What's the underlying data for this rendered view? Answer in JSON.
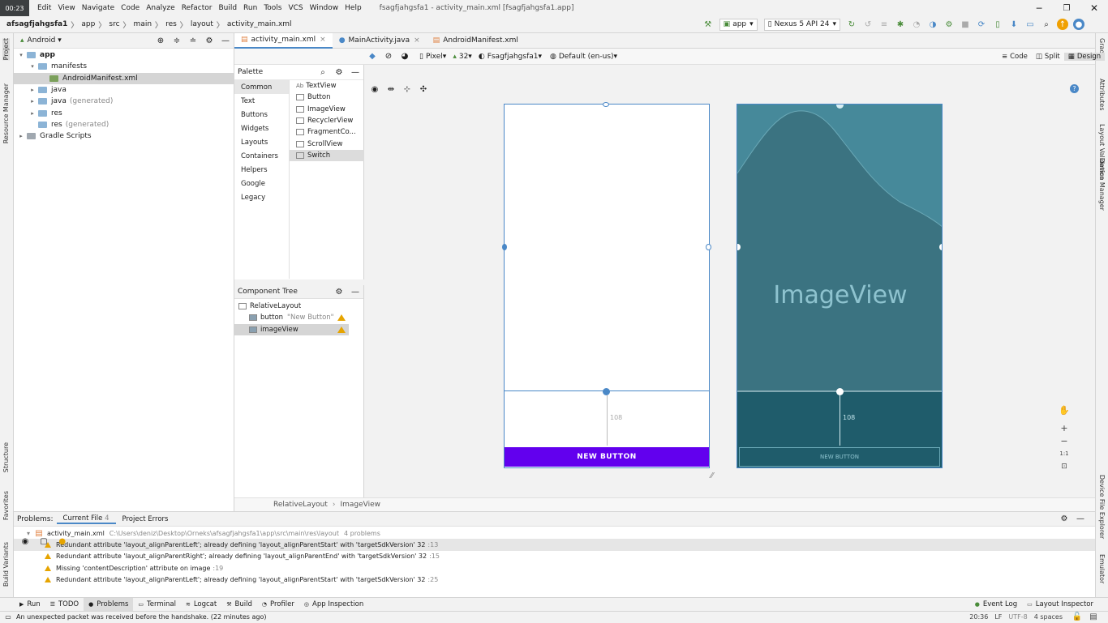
{
  "window": {
    "clock": "00:23",
    "title": "fsagfjahgsfa1 - activity_main.xml [fsagfjahgsfa1.app]",
    "menu": [
      "Edit",
      "View",
      "Navigate",
      "Code",
      "Analyze",
      "Refactor",
      "Build",
      "Run",
      "Tools",
      "VCS",
      "Window",
      "Help"
    ]
  },
  "breadcrumb": [
    "afsagfjahgsfa1",
    "app",
    "src",
    "main",
    "res",
    "layout",
    "activity_main.xml"
  ],
  "run_config": {
    "module": "app",
    "device": "Nexus 5 API 24"
  },
  "project": {
    "view": "Android",
    "tree": [
      {
        "label": "app",
        "indent": 0,
        "arrow": "▾",
        "icon": "folder",
        "bold": true
      },
      {
        "label": "manifests",
        "indent": 1,
        "arrow": "▾",
        "icon": "folder"
      },
      {
        "label": "AndroidManifest.xml",
        "indent": 2,
        "arrow": "",
        "icon": "file",
        "selected": true
      },
      {
        "label": "java",
        "indent": 1,
        "arrow": "▸",
        "icon": "folder"
      },
      {
        "label": "java",
        "suffix": "(generated)",
        "indent": 1,
        "arrow": "▸",
        "icon": "folder"
      },
      {
        "label": "res",
        "indent": 1,
        "arrow": "▸",
        "icon": "folder"
      },
      {
        "label": "res",
        "suffix": "(generated)",
        "indent": 1,
        "arrow": "",
        "icon": "folder"
      },
      {
        "label": "Gradle Scripts",
        "indent": 0,
        "arrow": "▸",
        "icon": "gradle"
      }
    ]
  },
  "left_strip": {
    "project": "Project",
    "resource_manager": "Resource Manager",
    "structure": "Structure",
    "favorites": "Favorites",
    "build_variants": "Build Variants"
  },
  "right_strip": {
    "gradle": "Gradle",
    "attributes": "Attributes",
    "layout_validation": "Layout Validation",
    "device_manager": "Device Manager",
    "device_file_explorer": "Device File Explorer",
    "emulator": "Emulator"
  },
  "editor_tabs": [
    "activity_main.xml",
    "MainActivity.java",
    "AndroidManifest.xml"
  ],
  "view_modes": [
    "Code",
    "Split",
    "Design"
  ],
  "design_toolbar": {
    "device": "Pixel",
    "api": "32",
    "theme": "Fsagfjahgsfa1",
    "locale": "Default (en-us)"
  },
  "palette": {
    "title": "Palette",
    "categories": [
      "Common",
      "Text",
      "Buttons",
      "Widgets",
      "Layouts",
      "Containers",
      "Helpers",
      "Google",
      "Legacy"
    ],
    "items": [
      "TextView",
      "Button",
      "ImageView",
      "RecyclerView",
      "FragmentCo...",
      "ScrollView",
      "Switch"
    ]
  },
  "component_tree": {
    "title": "Component Tree",
    "root": "RelativeLayout",
    "children": [
      {
        "label": "button",
        "hint": "\"New Button\"",
        "warning": true
      },
      {
        "label": "imageView",
        "hint": "",
        "warning": true,
        "selected": true
      }
    ]
  },
  "preview": {
    "button_label": "NEW BUTTON",
    "button_label_design": "NEW BUTTON",
    "margin_value": "108",
    "imageview_label": "ImageView",
    "accent_button": "#6200ee",
    "blueprint_line": "#4a88c7",
    "design_bg": "#3b7381"
  },
  "canvas_crumbs": [
    "RelativeLayout",
    "ImageView"
  ],
  "problems": {
    "title": "Problems:",
    "tabs": [
      {
        "label": "Current File",
        "count": "4"
      },
      {
        "label": "Project Errors",
        "count": ""
      }
    ],
    "file": "activity_main.xml",
    "path": "C:\\Users\\deniz\\Desktop\\Orneks\\afsagfjahgsfa1\\app\\src\\main\\res\\layout",
    "count": "4 problems",
    "items": [
      {
        "text": "Redundant attribute 'layout_alignParentLeft'; already defining 'layout_alignParentStart' with 'targetSdkVersion' 32",
        "line": ":13"
      },
      {
        "text": "Redundant attribute 'layout_alignParentRight'; already defining 'layout_alignParentEnd' with 'targetSdkVersion' 32",
        "line": ":15"
      },
      {
        "text": "Missing 'contentDescription' attribute on image",
        "line": ":19"
      },
      {
        "text": "Redundant attribute 'layout_alignParentLeft'; already defining 'layout_alignParentStart' with 'targetSdkVersion' 32",
        "line": ":25"
      }
    ]
  },
  "bottom_tabs": [
    "Run",
    "TODO",
    "Problems",
    "Terminal",
    "Logcat",
    "Build",
    "Profiler",
    "App Inspection"
  ],
  "bottom_right_tabs": [
    "Event Log",
    "Layout Inspector"
  ],
  "status": {
    "message": "An unexpected packet was received before the handshake. (22 minutes ago)",
    "time": "20:36",
    "line_sep": "LF",
    "encoding": "UTF-8",
    "indent": "4 spaces"
  }
}
